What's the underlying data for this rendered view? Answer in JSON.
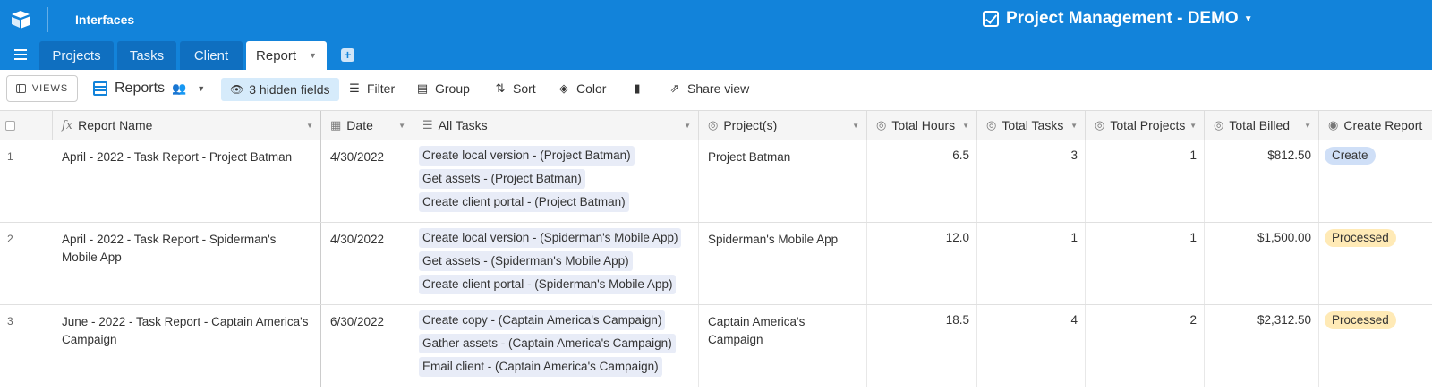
{
  "app": {
    "nav_label": "Interfaces",
    "base_title": "Project Management - DEMO",
    "accent_color": "#1283da"
  },
  "tabs": [
    {
      "label": "Projects",
      "active": false
    },
    {
      "label": "Tasks",
      "active": false
    },
    {
      "label": "Client",
      "active": false
    },
    {
      "label": "Report",
      "active": true
    }
  ],
  "toolbar": {
    "views_label": "VIEWS",
    "view_name": "Reports",
    "hidden_fields": "3 hidden fields",
    "filter": "Filter",
    "group": "Group",
    "sort": "Sort",
    "color": "Color",
    "share": "Share view"
  },
  "columns": {
    "report_name": "Report Name",
    "date": "Date",
    "all_tasks": "All Tasks",
    "projects": "Project(s)",
    "total_hours": "Total Hours",
    "total_tasks": "Total Tasks",
    "total_projects": "Total Projects",
    "total_billed": "Total Billed",
    "create_report": "Create Report"
  },
  "rows": [
    {
      "num": "1",
      "name": "April - 2022 - Task Report - Project Batman",
      "date": "4/30/2022",
      "tasks": [
        "Create local version - (Project Batman)",
        "Get assets - (Project Batman)",
        "Create client portal - (Project Batman)"
      ],
      "project": "Project Batman",
      "hours": "6.5",
      "total_tasks": "3",
      "total_projects": "1",
      "billed": "$812.50",
      "status": "Create",
      "status_color": "#cfdff7"
    },
    {
      "num": "2",
      "name": "April - 2022 - Task Report - Spiderman's Mobile App",
      "date": "4/30/2022",
      "tasks": [
        "Create local version - (Spiderman's Mobile App)",
        "Get assets - (Spiderman's Mobile App)",
        "Create client portal - (Spiderman's Mobile App)"
      ],
      "project": "Spiderman's Mobile App",
      "hours": "12.0",
      "total_tasks": "1",
      "total_projects": "1",
      "billed": "$1,500.00",
      "status": "Processed",
      "status_color": "#ffeab6"
    },
    {
      "num": "3",
      "name": "June - 2022 - Task Report - Captain America's Campaign",
      "date": "6/30/2022",
      "tasks": [
        "Create copy - (Captain America's Campaign)",
        "Gather assets - (Captain America's Campaign)",
        "Email client - (Captain America's Campaign)"
      ],
      "project": "Captain America's Campaign",
      "hours": "18.5",
      "total_tasks": "4",
      "total_projects": "2",
      "billed": "$2,312.50",
      "status": "Processed",
      "status_color": "#ffeab6"
    }
  ]
}
